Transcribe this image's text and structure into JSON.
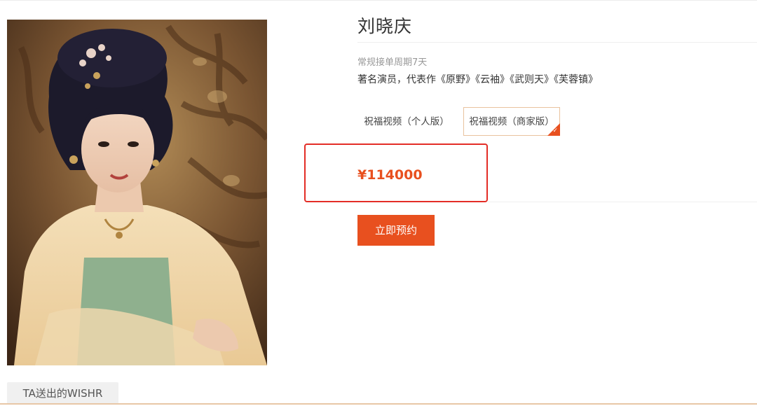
{
  "profile": {
    "name": "刘晓庆",
    "order_cycle": "常规接单周期7天",
    "description": "著名演员，代表作《原野》《云袖》《武则天》《芙蓉镇》"
  },
  "options": [
    {
      "label": "祝福视频（个人版）",
      "selected": false
    },
    {
      "label": "祝福视频（商家版）",
      "selected": true
    }
  ],
  "price": "¥114000",
  "book_button": "立即预约",
  "section_tab": "TA送出的WISHR",
  "colors": {
    "accent": "#e8501f",
    "highlight_box": "#e32d26",
    "selected_border": "#e9c29e",
    "section_rule": "#e8c7a6"
  },
  "icons": {
    "selected_marker": "check-corner-icon"
  }
}
